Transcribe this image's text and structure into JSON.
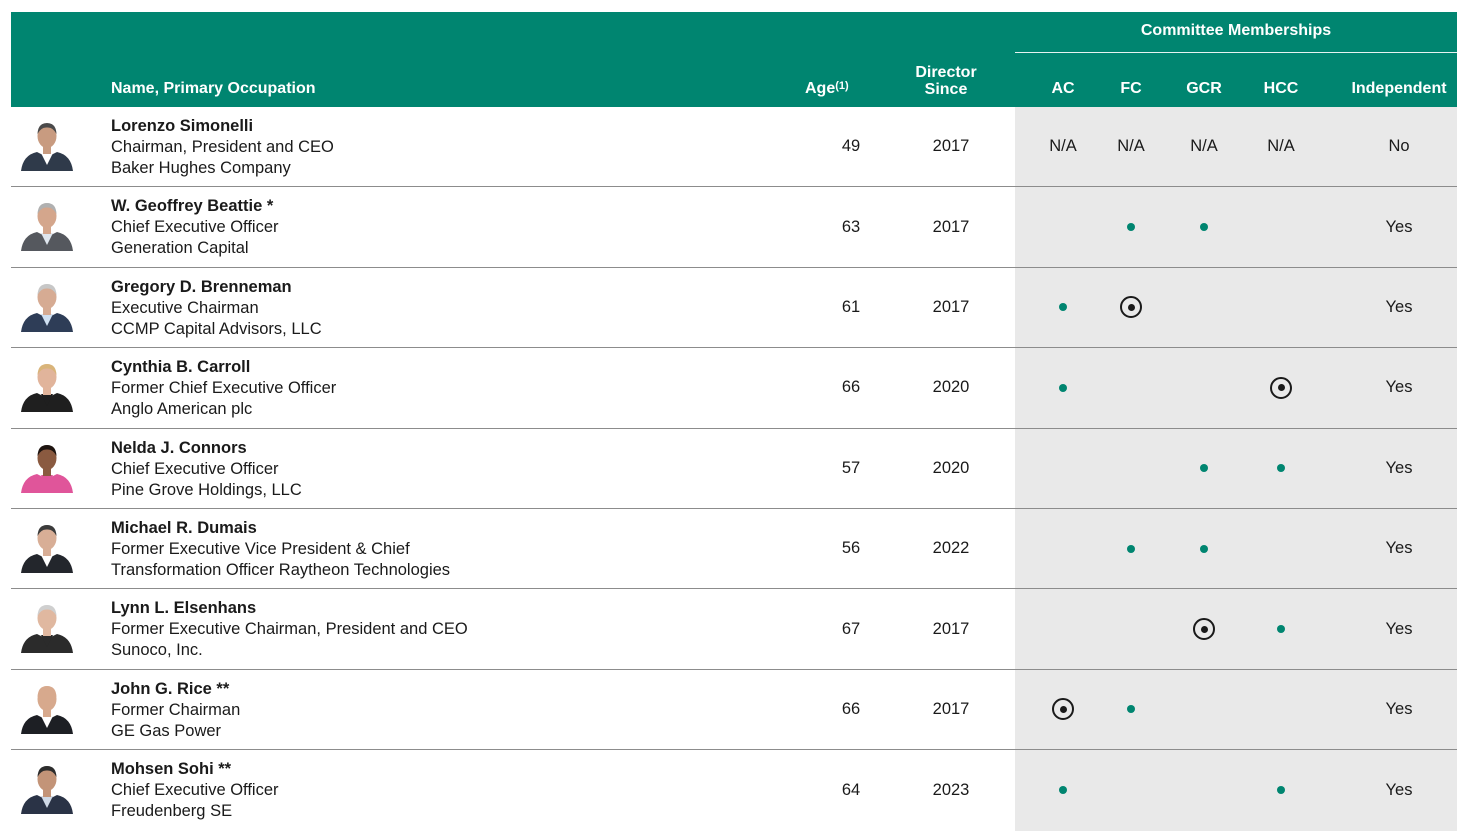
{
  "header": {
    "group": "Committee Memberships",
    "name": "Name, Primary Occupation",
    "age": "Age",
    "age_note": "(1)",
    "since_1": "Director",
    "since_2": "Since",
    "cols": [
      "AC",
      "FC",
      "GCR",
      "HCC",
      "Independent"
    ]
  },
  "legend": {
    "member": "dot",
    "chair": "circled-dot"
  },
  "colors": {
    "header_bg": "#008570",
    "member_dot": "#008570",
    "committee_shade": "#e9e9e9"
  },
  "directors": [
    {
      "name": "Lorenzo Simonelli",
      "occ1": "Chairman, President and CEO",
      "occ2": "Baker Hughes Company",
      "age": "49",
      "since": "2017",
      "ac": "N/A",
      "fc": "N/A",
      "gcr": "N/A",
      "hcc": "N/A",
      "ind": "No",
      "photo": {
        "skin": "#c89b80",
        "hair": "#4a4a4a",
        "top": "#2f3a4a",
        "shirt": "#ffffff"
      }
    },
    {
      "name": "W. Geoffrey Beattie *",
      "occ1": "Chief Executive Officer",
      "occ2": "Generation Capital",
      "age": "63",
      "since": "2017",
      "ac": "",
      "fc": "member",
      "gcr": "member",
      "hcc": "",
      "ind": "Yes",
      "photo": {
        "skin": "#d4a68c",
        "hair": "#b0b0b0",
        "top": "#55585e",
        "shirt": "#dfe6ee"
      }
    },
    {
      "name": "Gregory D. Brenneman",
      "occ1": "Executive Chairman",
      "occ2": "CCMP Capital Advisors, LLC",
      "age": "61",
      "since": "2017",
      "ac": "member",
      "fc": "chair",
      "gcr": "",
      "hcc": "",
      "ind": "Yes",
      "photo": {
        "skin": "#d6ab93",
        "hair": "#c7c7c7",
        "top": "#2e3d57",
        "shirt": "#cfe0f2"
      }
    },
    {
      "name": "Cynthia B. Carroll",
      "occ1": "Former Chief Executive Officer",
      "occ2": "Anglo American plc",
      "age": "66",
      "since": "2020",
      "ac": "member",
      "fc": "",
      "gcr": "",
      "hcc": "chair",
      "ind": "Yes",
      "photo": {
        "skin": "#e1b49b",
        "hair": "#d9b47a",
        "top": "#1f1f1f",
        "shirt": "#1f1f1f"
      }
    },
    {
      "name": "Nelda J. Connors",
      "occ1": "Chief Executive Officer",
      "occ2": "Pine Grove Holdings, LLC",
      "age": "57",
      "since": "2020",
      "ac": "",
      "fc": "",
      "gcr": "member",
      "hcc": "member",
      "ind": "Yes",
      "photo": {
        "skin": "#8a5a40",
        "hair": "#1e1410",
        "top": "#e0559a",
        "shirt": "#e0559a"
      }
    },
    {
      "name": "Michael R. Dumais",
      "occ1": "Former Executive Vice President & Chief",
      "occ2": "Transformation Officer Raytheon Technologies",
      "age": "56",
      "since": "2022",
      "ac": "",
      "fc": "member",
      "gcr": "member",
      "hcc": "",
      "ind": "Yes",
      "photo": {
        "skin": "#d8ae96",
        "hair": "#3b3b3b",
        "top": "#23262c",
        "shirt": "#ffffff"
      }
    },
    {
      "name": "Lynn L. Elsenhans",
      "occ1": "Former Executive Chairman, President and CEO",
      "occ2": "Sunoco, Inc.",
      "age": "67",
      "since": "2017",
      "ac": "",
      "fc": "",
      "gcr": "chair",
      "hcc": "member",
      "ind": "Yes",
      "photo": {
        "skin": "#e0b8a0",
        "hair": "#cfcfcf",
        "top": "#2b2b2b",
        "shirt": "#2b2b2b"
      }
    },
    {
      "name": "John G. Rice **",
      "occ1": "Former Chairman",
      "occ2": "GE Gas Power",
      "age": "66",
      "since": "2017",
      "ac": "chair",
      "fc": "member",
      "gcr": "",
      "hcc": "",
      "ind": "Yes",
      "photo": {
        "skin": "#d7a98d",
        "hair": "#d7a98d",
        "top": "#1d1f24",
        "shirt": "#ffffff"
      }
    },
    {
      "name": "Mohsen Sohi **",
      "occ1": "Chief Executive Officer",
      "occ2": "Freudenberg SE",
      "age": "64",
      "since": "2023",
      "ac": "member",
      "fc": "",
      "gcr": "",
      "hcc": "member",
      "ind": "Yes",
      "photo": {
        "skin": "#c39478",
        "hair": "#2c2c2c",
        "top": "#2a3346",
        "shirt": "#cfd9e6"
      }
    }
  ]
}
